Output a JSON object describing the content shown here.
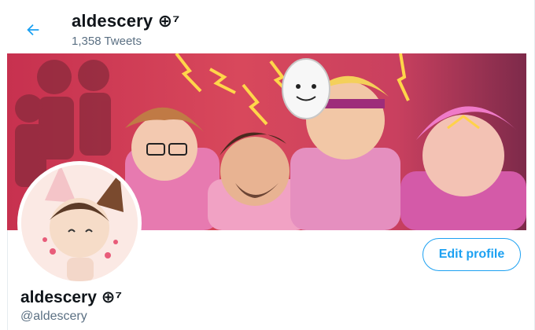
{
  "header": {
    "name": "aldescery",
    "name_suffix": "⊕⁷",
    "tweet_count": "1,358 Tweets"
  },
  "profile": {
    "name": "aldescery",
    "name_suffix": "⊕⁷",
    "handle": "@aldescery",
    "edit_label": "Edit profile"
  },
  "colors": {
    "accent": "#1da1f2",
    "secondary_text": "#5b7083",
    "banner_red": "#c93a5b",
    "banner_pink": "#e86fb7"
  },
  "icons": {
    "back": "arrow-left-icon"
  }
}
